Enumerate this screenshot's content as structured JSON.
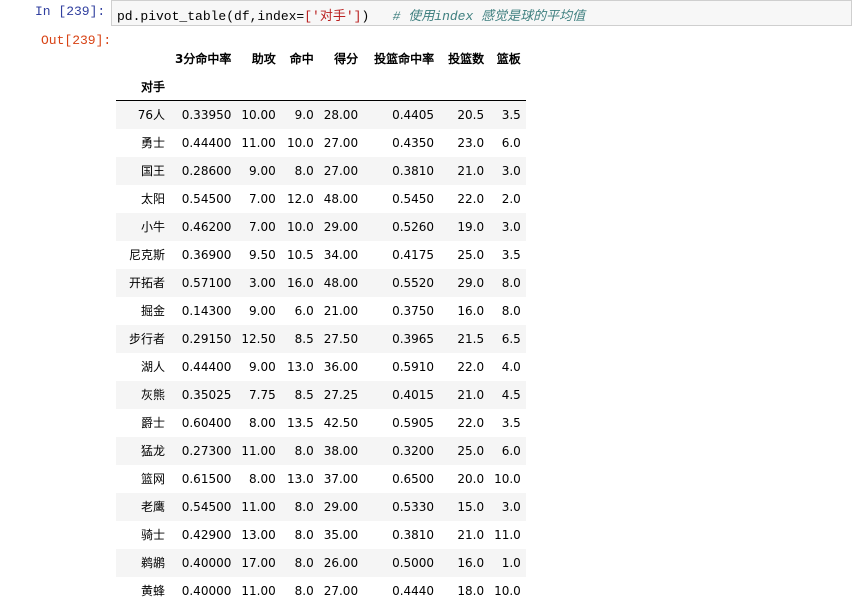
{
  "input_cell": {
    "prompt": "In  [239]:",
    "code_pre": "pd.pivot_table(df,index=",
    "code_str": "['对手']",
    "code_post": ")   ",
    "code_comment": "# 使用index 感觉是球的平均值"
  },
  "output_cell": {
    "prompt": "Out[239]:"
  },
  "table": {
    "index_name": "对手",
    "columns": [
      "3分命中率",
      "助攻",
      "命中",
      "得分",
      "投篮命中率",
      "投篮数",
      "篮板"
    ],
    "rows": [
      {
        "index": "76人",
        "values": [
          "0.33950",
          "10.00",
          "9.0",
          "28.00",
          "0.4405",
          "20.5",
          "3.5"
        ]
      },
      {
        "index": "勇士",
        "values": [
          "0.44400",
          "11.00",
          "10.0",
          "27.00",
          "0.4350",
          "23.0",
          "6.0"
        ]
      },
      {
        "index": "国王",
        "values": [
          "0.28600",
          "9.00",
          "8.0",
          "27.00",
          "0.3810",
          "21.0",
          "3.0"
        ]
      },
      {
        "index": "太阳",
        "values": [
          "0.54500",
          "7.00",
          "12.0",
          "48.00",
          "0.5450",
          "22.0",
          "2.0"
        ]
      },
      {
        "index": "小牛",
        "values": [
          "0.46200",
          "7.00",
          "10.0",
          "29.00",
          "0.5260",
          "19.0",
          "3.0"
        ]
      },
      {
        "index": "尼克斯",
        "values": [
          "0.36900",
          "9.50",
          "10.5",
          "34.00",
          "0.4175",
          "25.0",
          "3.5"
        ]
      },
      {
        "index": "开拓者",
        "values": [
          "0.57100",
          "3.00",
          "16.0",
          "48.00",
          "0.5520",
          "29.0",
          "8.0"
        ]
      },
      {
        "index": "掘金",
        "values": [
          "0.14300",
          "9.00",
          "6.0",
          "21.00",
          "0.3750",
          "16.0",
          "8.0"
        ]
      },
      {
        "index": "步行者",
        "values": [
          "0.29150",
          "12.50",
          "8.5",
          "27.50",
          "0.3965",
          "21.5",
          "6.5"
        ]
      },
      {
        "index": "湖人",
        "values": [
          "0.44400",
          "9.00",
          "13.0",
          "36.00",
          "0.5910",
          "22.0",
          "4.0"
        ]
      },
      {
        "index": "灰熊",
        "values": [
          "0.35025",
          "7.75",
          "8.5",
          "27.25",
          "0.4015",
          "21.0",
          "4.5"
        ]
      },
      {
        "index": "爵士",
        "values": [
          "0.60400",
          "8.00",
          "13.5",
          "42.50",
          "0.5905",
          "22.0",
          "3.5"
        ]
      },
      {
        "index": "猛龙",
        "values": [
          "0.27300",
          "11.00",
          "8.0",
          "38.00",
          "0.3200",
          "25.0",
          "6.0"
        ]
      },
      {
        "index": "篮网",
        "values": [
          "0.61500",
          "8.00",
          "13.0",
          "37.00",
          "0.6500",
          "20.0",
          "10.0"
        ]
      },
      {
        "index": "老鹰",
        "values": [
          "0.54500",
          "11.00",
          "8.0",
          "29.00",
          "0.5330",
          "15.0",
          "3.0"
        ]
      },
      {
        "index": "骑士",
        "values": [
          "0.42900",
          "13.00",
          "8.0",
          "35.00",
          "0.3810",
          "21.0",
          "11.0"
        ]
      },
      {
        "index": "鹈鹕",
        "values": [
          "0.40000",
          "17.00",
          "8.0",
          "26.00",
          "0.5000",
          "16.0",
          "1.0"
        ]
      },
      {
        "index": "黄蜂",
        "values": [
          "0.40000",
          "11.00",
          "8.0",
          "27.00",
          "0.4440",
          "18.0",
          "10.0"
        ]
      }
    ]
  }
}
